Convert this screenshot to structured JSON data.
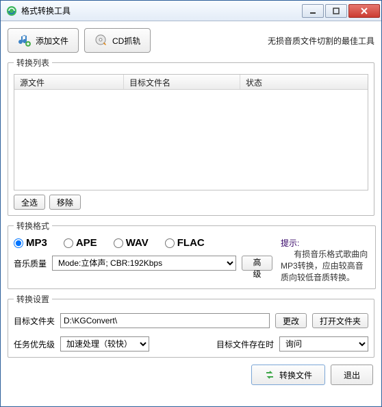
{
  "window": {
    "title": "格式转换工具"
  },
  "toolbar": {
    "add_file": "添加文件",
    "cd_grab": "CD抓轨",
    "slogan": "无损音质文件切割的最佳工具"
  },
  "list": {
    "legend": "转换列表",
    "columns": [
      "源文件",
      "目标文件名",
      "状态"
    ],
    "select_all": "全选",
    "remove": "移除"
  },
  "format": {
    "legend": "转换格式",
    "options": [
      "MP3",
      "APE",
      "WAV",
      "FLAC"
    ],
    "selected": "MP3",
    "quality_label": "音乐质量",
    "quality_value": "Mode:立体声; CBR:192Kbps",
    "advanced": "高级",
    "hint_title": "提示:",
    "hint_body": "有损音乐格式歌曲向MP3转换，应由较高音质向较低音质转换。"
  },
  "settings": {
    "legend": "转换设置",
    "target_folder_label": "目标文件夹",
    "target_folder_value": "D:\\KGConvert\\",
    "change": "更改",
    "open_folder": "打开文件夹",
    "priority_label": "任务优先级",
    "priority_value": "加速处理（较快）",
    "exists_label": "目标文件存在时",
    "exists_value": "询问"
  },
  "bottom": {
    "convert": "转换文件",
    "exit": "退出"
  }
}
